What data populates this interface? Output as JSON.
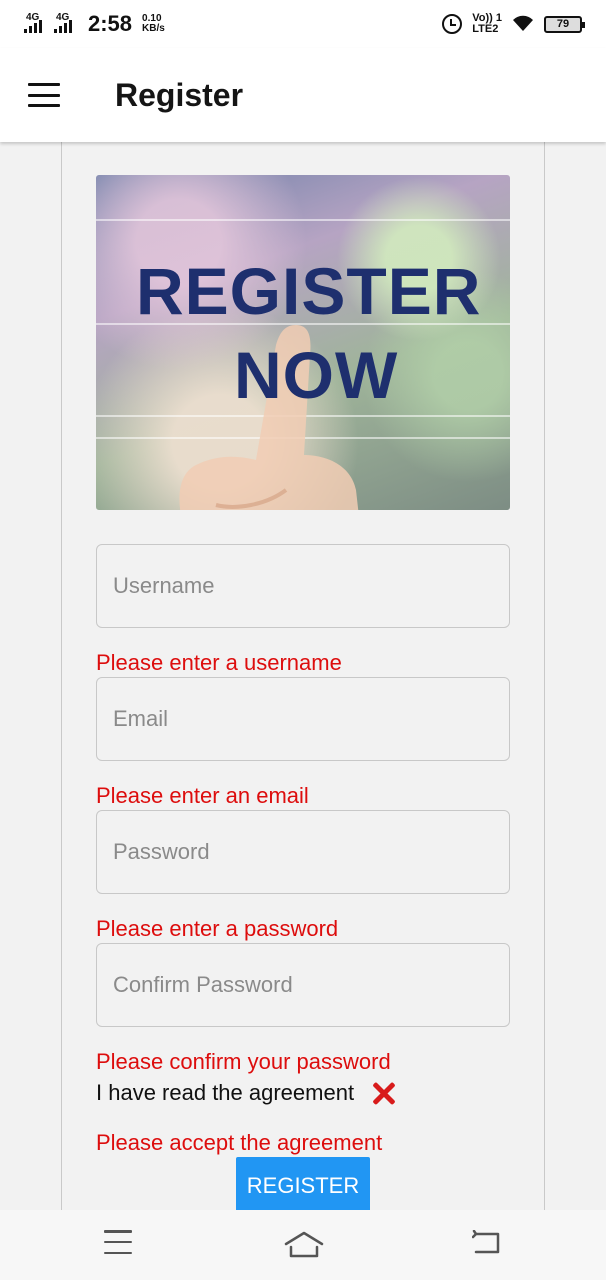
{
  "status_bar": {
    "network1": "4G",
    "network2": "4G",
    "time": "2:58",
    "speed_value": "0.10",
    "speed_unit": "KB/s",
    "volte_top": "Vo)) 1",
    "volte_bottom": "LTE2",
    "battery": "79"
  },
  "app_bar": {
    "title": "Register",
    "menu_icon": "hamburger-menu-icon"
  },
  "banner": {
    "line1": "REGISTER",
    "line2": "NOW"
  },
  "form": {
    "username": {
      "value": "",
      "placeholder": "Username",
      "error": "Please enter a username"
    },
    "email": {
      "value": "",
      "placeholder": "Email",
      "error": "Please enter an email"
    },
    "password": {
      "value": "",
      "placeholder": "Password",
      "error": "Please enter a password"
    },
    "confirm_password": {
      "value": "",
      "placeholder": "Confirm Password",
      "error": "Please confirm your password"
    },
    "agreement": {
      "label": "I have read the agreement",
      "checked": false,
      "status_icon": "red-x-icon",
      "error": "Please accept the agreement"
    },
    "submit_label": "REGISTER"
  },
  "colors": {
    "error": "#dd0d0d",
    "primary": "#2196f3",
    "banner_text": "#1e2f6e"
  },
  "nav_bar": {
    "icons": [
      "menu-icon",
      "home-icon",
      "back-icon"
    ]
  }
}
